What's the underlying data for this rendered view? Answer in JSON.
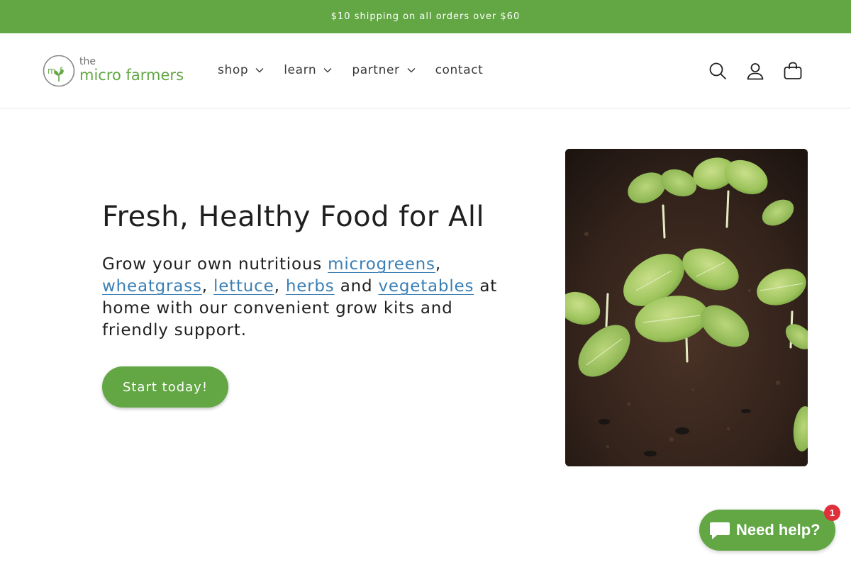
{
  "announcement": {
    "text": "$10 shipping on all orders over $60"
  },
  "header": {
    "logo": {
      "mark": "mf",
      "the": "the",
      "name": "micro farmers",
      "tm": "™"
    },
    "nav": [
      {
        "label": "shop",
        "has_dropdown": true
      },
      {
        "label": "learn",
        "has_dropdown": true
      },
      {
        "label": "partner",
        "has_dropdown": true
      },
      {
        "label": "contact",
        "has_dropdown": false
      }
    ],
    "icons": [
      "search-icon",
      "account-icon",
      "cart-icon"
    ]
  },
  "hero": {
    "title": "Fresh, Healthy Food for All",
    "desc_prefix": "Grow your own nutritious ",
    "links": [
      "microgreens",
      "wheatgrass",
      "lettuce",
      "herbs",
      "vegetables"
    ],
    "sep_comma": ", ",
    "sep_and": " and ",
    "desc_suffix": " at home with our convenient grow kits and friendly support.",
    "cta_label": "Start today!",
    "image_alt": "seedlings sprouting in soil"
  },
  "chat": {
    "label": "Need help?",
    "badge_count": "1"
  },
  "colors": {
    "brand_green": "#62a744",
    "link_blue": "#3a7fb5",
    "badge_red": "#e0303a"
  }
}
